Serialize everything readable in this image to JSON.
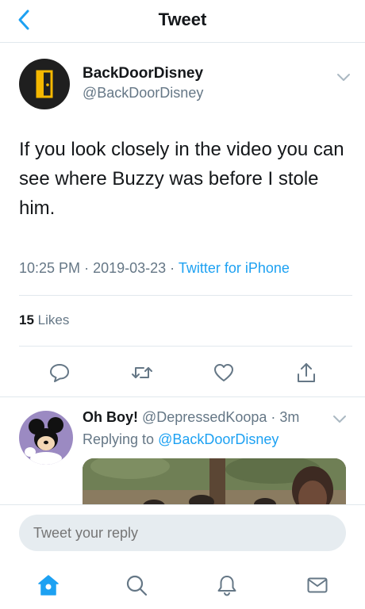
{
  "header": {
    "title": "Tweet",
    "back_icon": "chevron-left-icon"
  },
  "tweet": {
    "author_name": "BackDoorDisney",
    "author_handle": "@BackDoorDisney",
    "text": "If you look closely in the video you can see where Buzzy was before I stole him.",
    "time": "10:25 PM",
    "date": "2019-03-23",
    "source": "Twitter for iPhone",
    "likes_count": "15",
    "likes_label": "Likes"
  },
  "reply": {
    "name": "Oh Boy!",
    "handle": "@DepressedKoopa",
    "age": "3m",
    "replying_label": "Replying to",
    "replying_to": "@BackDoorDisney"
  },
  "composer": {
    "placeholder": "Tweet your reply"
  },
  "colors": {
    "accent": "#1da1f2",
    "secondary_text": "#657786",
    "divider": "#e1e8ed"
  }
}
